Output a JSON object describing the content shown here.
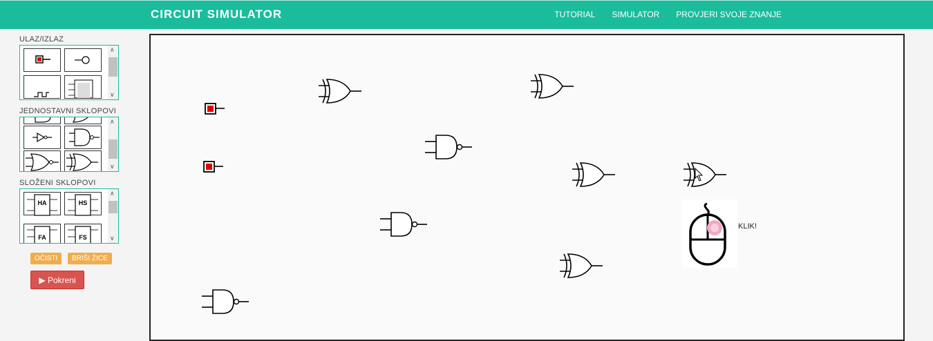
{
  "app": {
    "title": "CIRCUIT SIMULATOR"
  },
  "nav": {
    "items": [
      "TUTORIAL",
      "SIMULATOR",
      "PROVJERI SVOJE ZNANJE"
    ]
  },
  "palette": {
    "sections": [
      "ULAZ/IZLAZ",
      "JEDNOSTAVNI SKLOPOVI",
      "SLOŽENI SKLOPOVI"
    ],
    "complex_labels": [
      "HA",
      "HS",
      "FA",
      "FS"
    ]
  },
  "buttons": {
    "clear": "OČISTI",
    "delete_wires": "BRIŠI ŽICE",
    "run": "Pokreni"
  },
  "canvas": {
    "hint": "KLIK!"
  },
  "icons": {
    "run": "play-icon",
    "hint": "mouse-icon"
  },
  "colors": {
    "accent": "#1abc9c",
    "switch_on": "#e00000",
    "warn": "#f0ad4e",
    "danger": "#d9534f"
  }
}
